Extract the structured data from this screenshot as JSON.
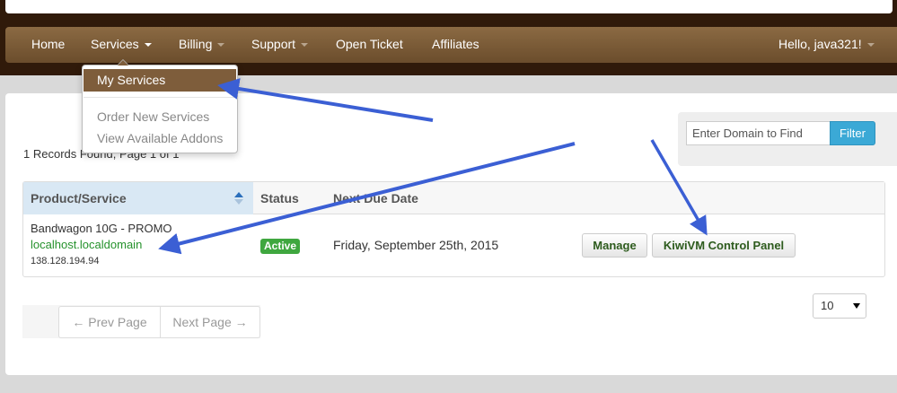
{
  "nav": {
    "home": "Home",
    "services": "Services",
    "billing": "Billing",
    "support": "Support",
    "open_ticket": "Open Ticket",
    "affiliates": "Affiliates",
    "user": "Hello, java321!"
  },
  "services_menu": {
    "my_services": "My Services",
    "order_new": "Order New Services",
    "view_addons": "View Available Addons"
  },
  "records_text": "1 Records Found, Page 1 of 1",
  "search": {
    "placeholder": "Enter Domain to Find",
    "filter_label": "Filter"
  },
  "table": {
    "headers": {
      "product": "Product/Service",
      "status": "Status",
      "next_due": "Next Due Date"
    },
    "rows": [
      {
        "product": "Bandwagon 10G - PROMO",
        "domain": "localhost.localdomain",
        "ip": "138.128.194.94",
        "status": "Active",
        "next_due": "Friday, September 25th, 2015",
        "manage_label": "Manage",
        "panel_label": "KiwiVM Control Panel"
      }
    ]
  },
  "pagination": {
    "prev": "← Prev Page",
    "next": "Next Page →"
  },
  "per_page": "10",
  "colors": {
    "navbar": "#7a5a37",
    "accent": "#3ba9d6",
    "active_badge": "#3fa73f",
    "annotation_arrow": "#3b5fd4"
  }
}
